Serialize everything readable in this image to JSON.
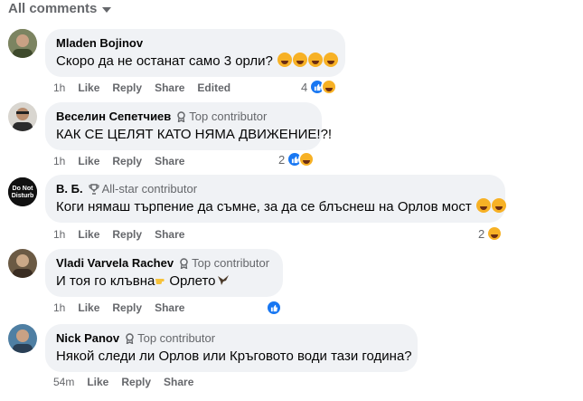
{
  "header": {
    "label": "All comments"
  },
  "comments": [
    {
      "author": "Mladen Bojinov",
      "badge": "",
      "text": "Скоро да не останат само 3 орли?",
      "emoji": [
        "laugh-emoji",
        "rofl-emoji",
        "laugh-emoji",
        "rofl-emoji"
      ],
      "time": "1h",
      "actions": [
        "Like",
        "Reply",
        "Share",
        "Edited"
      ],
      "reaction_count": "4",
      "reactions": [
        "like",
        "haha"
      ]
    },
    {
      "author": "Веселин Сепетчиев",
      "badge": "Top contributor",
      "text": "КАК СЕ ЦЕЛЯТ КАТО НЯМА ДВИЖЕНИЕ!?!",
      "emoji": [],
      "time": "1h",
      "actions": [
        "Like",
        "Reply",
        "Share"
      ],
      "reaction_count": "2",
      "reactions": [
        "like",
        "haha"
      ]
    },
    {
      "author": "В. Б.",
      "badge": "All-star contributor",
      "text": "Коги нямаш търпение да съмне, за да се блъснеш на Орлов мост",
      "emoji": [
        "rofl-emoji",
        "rofl-emoji"
      ],
      "time": "1h",
      "actions": [
        "Like",
        "Reply",
        "Share"
      ],
      "reaction_count": "2",
      "reactions": [
        "haha"
      ],
      "avatar_text": "Do Not Disturb"
    },
    {
      "author": "Vladi Varvela Rachev",
      "badge": "Top contributor",
      "text_parts": [
        "И тоя го клъвна",
        "Орлето"
      ],
      "time": "1h",
      "actions": [
        "Like",
        "Reply",
        "Share"
      ],
      "reaction_count": "",
      "reactions": [
        "like"
      ]
    },
    {
      "author": "Nick Panov",
      "badge": "Top contributor",
      "text": "Някой следи ли Орлов или Кръговото води тази година?",
      "emoji": [],
      "time": "54m",
      "actions": [
        "Like",
        "Reply",
        "Share"
      ],
      "reaction_count": "",
      "reactions": []
    }
  ],
  "colors": {
    "bubble": "#f0f2f5",
    "muted": "#65676b",
    "like_blue": "#1877f2",
    "haha_yellow": "#f7b125"
  }
}
